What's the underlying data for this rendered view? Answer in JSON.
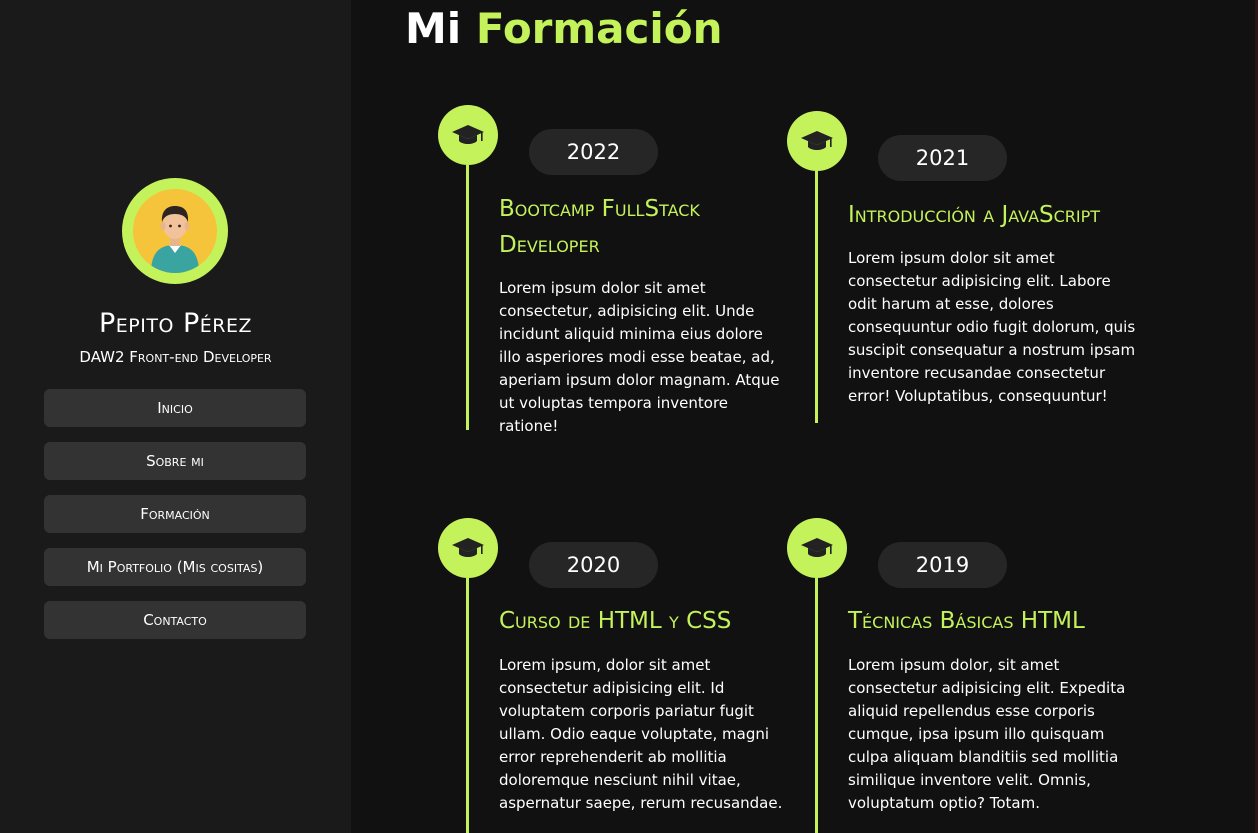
{
  "profile": {
    "name": "Pepito Pérez",
    "role": "DAW2 Front-end Developer"
  },
  "nav": {
    "items": [
      {
        "label": "Inicio"
      },
      {
        "label": "Sobre mi"
      },
      {
        "label": "Formación"
      },
      {
        "label": "Mi Portfolio (Mis cositas)"
      },
      {
        "label": "Contacto"
      }
    ]
  },
  "page": {
    "title_prefix": "Mi",
    "title_accent": "Formación"
  },
  "education": [
    {
      "year": "2022",
      "title": "Bootcamp FullStack Developer",
      "description": "Lorem ipsum dolor sit amet consectetur, adipisicing elit. Unde incidunt aliquid minima eius dolore illo asperiores modi esse beatae, ad, aperiam ipsum dolor magnam. Atque ut voluptas tempora inventore ratione!"
    },
    {
      "year": "2021",
      "title": "Introducción a JavaScript",
      "description": "Lorem ipsum dolor sit amet consectetur adipisicing elit. Labore odit harum at esse, dolores consequuntur odio fugit dolorum, quis suscipit consequatur a nostrum ipsam inventore recusandae consectetur error! Voluptatibus, consequuntur!"
    },
    {
      "year": "2020",
      "title": "Curso de HTML y CSS",
      "description": "Lorem ipsum, dolor sit amet consectetur adipisicing elit. Id voluptatem corporis pariatur fugit ullam. Odio eaque voluptate, magni error reprehenderit ab mollitia doloremque nesciunt nihil vitae, aspernatur saepe, rerum recusandae."
    },
    {
      "year": "2019",
      "title": "Técnicas Básicas HTML",
      "description": "Lorem ipsum dolor, sit amet consectetur adipisicing elit. Expedita aliquid repellendus esse corporis cumque, ipsa ipsum illo quisquam culpa aliquam blanditiis sed mollitia similique inventore velit. Omnis, voluptatum optio? Totam."
    }
  ],
  "icons": {
    "education_icon": "graduation-cap-icon",
    "avatar_icon": "user-avatar-icon"
  },
  "colors": {
    "accent": "#c4f25b",
    "background": "#111111",
    "sidebar": "#1a1a1a",
    "button": "#333333",
    "pill": "#262626"
  }
}
